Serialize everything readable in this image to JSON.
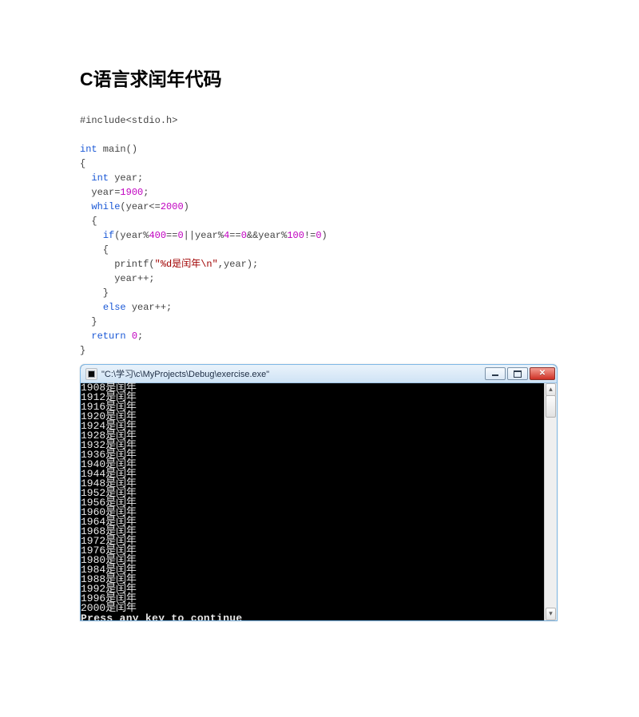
{
  "title": "C语言求闰年代码",
  "code": {
    "include": "#include<stdio.h>",
    "int_pre": "int",
    "main_sig": " main()",
    "lbrace": "{",
    "int_decl_kw": "int",
    "int_decl_rest": " year;",
    "assign_lhs": "  year=",
    "assign_num": "1900",
    "assign_end": ";",
    "while_kw": "while",
    "while_open": "(year<=",
    "while_num": "2000",
    "while_close": ")",
    "while_lbrace": "  {",
    "if_kw": "if",
    "if_open": "(year%",
    "if_n1": "400",
    "if_mid1": "==",
    "if_n2": "0",
    "if_mid2": "||year%",
    "if_n3": "4",
    "if_mid3": "==",
    "if_n4": "0",
    "if_mid4": "&&year%",
    "if_n5": "100",
    "if_mid5": "!=",
    "if_n6": "0",
    "if_close": ")",
    "if_lbrace": "    {",
    "printf_pre": "      printf(",
    "printf_str": "\"%d是闰年\\n\"",
    "printf_post": ",year);",
    "yearpp": "      year++;",
    "if_rbrace": "    }",
    "else_kw": "else",
    "else_rest": " year++;",
    "while_rbrace": "  }",
    "return_kw": "return",
    "return_sp": " ",
    "return_num": "0",
    "return_end": ";",
    "rbrace": "}"
  },
  "console": {
    "title": "\"C:\\学习\\c\\MyProjects\\Debug\\exercise.exe\"",
    "lines": [
      "1908",
      "1912",
      "1916",
      "1920",
      "1924",
      "1928",
      "1932",
      "1936",
      "1940",
      "1944",
      "1948",
      "1952",
      "1956",
      "1960",
      "1964",
      "1968",
      "1972",
      "1976",
      "1980",
      "1984",
      "1988",
      "1992",
      "1996",
      "2000"
    ],
    "suffix": "是闰年",
    "prompt": "Press any key to continue"
  },
  "window_buttons": {
    "minimize": "minimize",
    "maximize": "maximize",
    "close": "close"
  }
}
